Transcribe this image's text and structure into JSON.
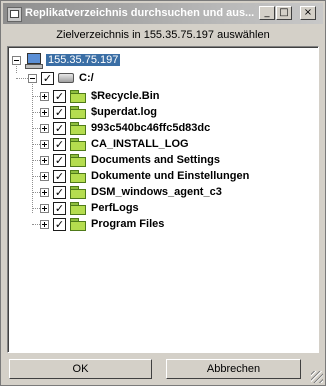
{
  "window": {
    "title": "Replikatverzeichnis durchsuchen und aus...",
    "buttons": {
      "minimize": "_",
      "maximize": "□",
      "close": "×"
    }
  },
  "subtitle": "Zielverzeichnis in 155.35.75.197 auswählen",
  "tree": {
    "server": {
      "label": "155.35.75.197",
      "icon": "computer-icon",
      "selected": true
    },
    "drive": {
      "label": "C:/",
      "icon": "drive-icon",
      "checked": true
    },
    "folders": [
      {
        "label": "$Recycle.Bin",
        "checked": true
      },
      {
        "label": "$uperdat.log",
        "checked": true
      },
      {
        "label": "993c540bc46ffc5d83dc",
        "checked": true
      },
      {
        "label": "CA_INSTALL_LOG",
        "checked": true
      },
      {
        "label": "Documents and Settings",
        "checked": true
      },
      {
        "label": "Dokumente und Einstellungen",
        "checked": true
      },
      {
        "label": "DSM_windows_agent_c3",
        "checked": true
      },
      {
        "label": "PerfLogs",
        "checked": true
      },
      {
        "label": "Program Files",
        "checked": true
      }
    ]
  },
  "footer": {
    "ok_label": "OK",
    "cancel_label": "Abbrechen"
  },
  "check_glyph": "✓"
}
